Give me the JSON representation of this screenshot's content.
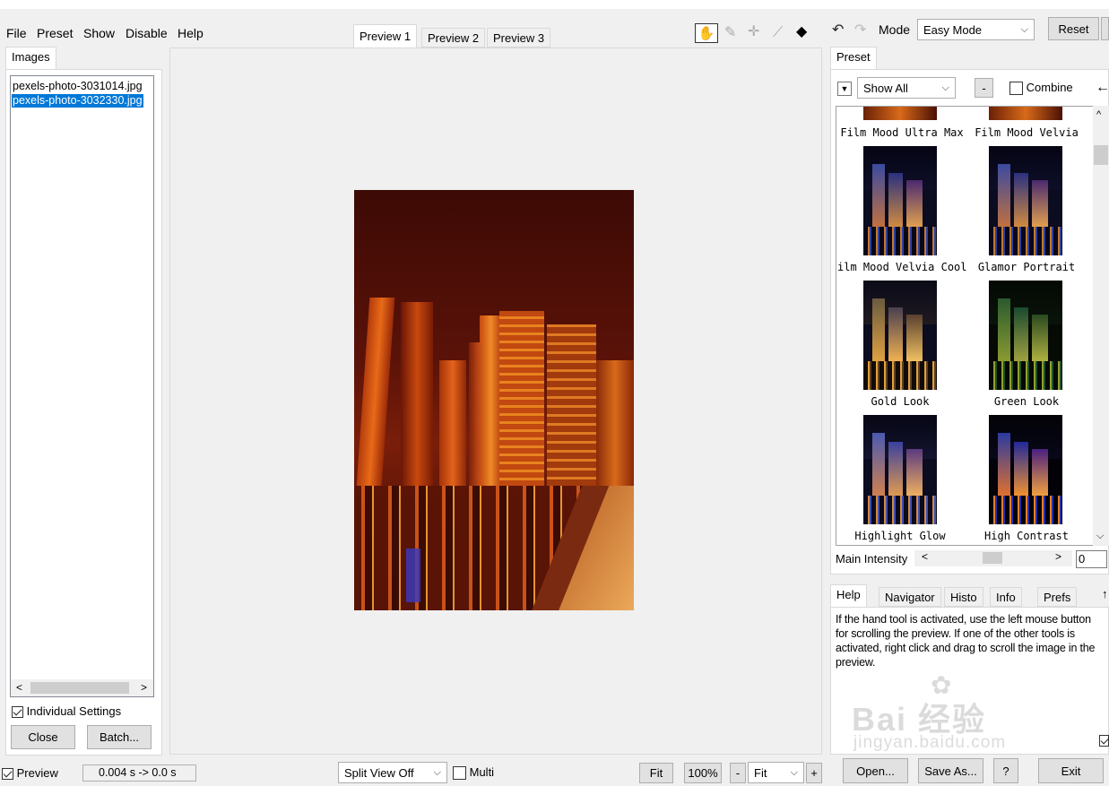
{
  "menu": [
    "File",
    "Preset",
    "Show",
    "Disable",
    "Help"
  ],
  "left_panel": {
    "tab": "Images",
    "files": [
      {
        "name": "pexels-photo-3031014.jpg",
        "selected": false
      },
      {
        "name": "pexels-photo-3032330.jpg",
        "selected": true
      }
    ],
    "individual_settings_label": "Individual Settings",
    "individual_settings_checked": true,
    "close_label": "Close",
    "batch_label": "Batch..."
  },
  "preview_tabs": [
    "Preview 1",
    "Preview 2",
    "Preview 3"
  ],
  "toolbar": {
    "mode_label": "Mode",
    "mode_value": "Easy Mode",
    "reset_label": "Reset"
  },
  "preset_panel": {
    "tab": "Preset",
    "filter_value": "Show All",
    "minus_label": "-",
    "combine_label": "Combine",
    "presets": [
      {
        "label": "Film Mood Ultra Max",
        "tone": "warm"
      },
      {
        "label": "Film Mood Velvia",
        "tone": "warm"
      },
      {
        "label": "ilm Mood Velvia Cool",
        "tone": "cool"
      },
      {
        "label": "Glamor Portrait",
        "tone": "cool"
      },
      {
        "label": "Gold Look",
        "tone": "gold"
      },
      {
        "label": "Green Look",
        "tone": "green"
      },
      {
        "label": "Highlight Glow",
        "tone": "cool"
      },
      {
        "label": "High Contrast",
        "tone": "contrast"
      }
    ],
    "main_intensity_label": "Main Intensity",
    "main_intensity_value": "0"
  },
  "info_panel": {
    "tabs": [
      "Help",
      "Navigator",
      "Histo",
      "Info",
      "Prefs"
    ],
    "help_text": "If the hand tool is activated, use the left mouse button for scrolling the preview. If one of the other tools is activated, right click and drag to scroll the image in the preview.",
    "watermark_main": "Bai 经验",
    "watermark_sub": "jingyan.baidu.com"
  },
  "statusbar": {
    "preview_label": "Preview",
    "preview_checked": true,
    "timing": "0.004 s -> 0.0 s",
    "split_view": "Split View Off",
    "multi_label": "Multi",
    "fit_label": "Fit",
    "zoom_100": "100%",
    "zoom_minus": "-",
    "zoom_value": "Fit",
    "zoom_plus": "+",
    "open_label": "Open...",
    "save_as_label": "Save As...",
    "help_label": "?",
    "exit_label": "Exit"
  },
  "colors": {
    "selection": "#0078d7",
    "panel_bg": "#f0f0f0",
    "photo_sky": "#4a0d06"
  }
}
